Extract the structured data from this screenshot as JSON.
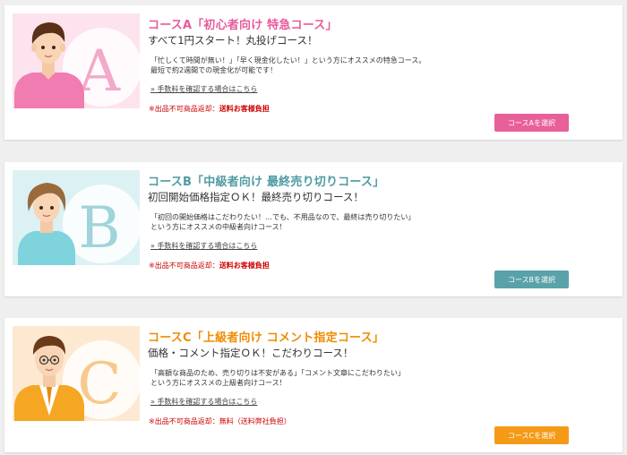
{
  "courses": [
    {
      "key": "a",
      "letter": "A",
      "title": "コースA「初心者向け 特急コース」",
      "subtitle": "すべて1円スタート！丸投げコース！",
      "desc_line1": "「忙しくて時間が無い！」「早く現金化したい！」という方にオススメの特急コース。",
      "desc_line2": "最短で約2週間での現金化が可能です！",
      "fee_link": "» 手数料を確認する場合はこちら",
      "note_prefix": "※出品不可商品返却：",
      "note_value": "送料お客様負担",
      "button": "コースAを選択",
      "colors": {
        "accent": "#e8609a",
        "image_bg": "#fde3ee",
        "letter": "#f3a9c9"
      }
    },
    {
      "key": "b",
      "letter": "B",
      "title": "コースB「中級者向け 最終売り切りコース」",
      "subtitle": "初回開始価格指定ＯＫ！最終売り切りコース！",
      "desc_line1": "「初回の開始価格はこだわりたい！…でも、不用品なので、最終は売り切りたい」",
      "desc_line2": "という方にオススメの中級者向けコース！",
      "fee_link": "» 手数料を確認する場合はこちら",
      "note_prefix": "※出品不可商品返却：",
      "note_value": "送料お客様負担",
      "button": "コースBを選択",
      "colors": {
        "accent": "#5aa2aa",
        "image_bg": "#dcf1f3",
        "letter": "#9fd4da"
      }
    },
    {
      "key": "c",
      "letter": "C",
      "title": "コースC「上級者向け コメント指定コース」",
      "subtitle": "価格・コメント指定ＯＫ！こだわりコース！",
      "desc_line1": "「高額な商品のため、売り切りは不安がある」「コメント文章にこだわりたい」",
      "desc_line2": "という方にオススメの上級者向けコース！",
      "fee_link": "» 手数料を確認する場合はこちら",
      "note_prefix": "※出品不可商品返却：",
      "note_value": "無料（送料弊社負担）",
      "button": "コースCを選択",
      "colors": {
        "accent": "#f59a16",
        "image_bg": "#fde9d2",
        "letter": "#f7c98e"
      }
    }
  ]
}
